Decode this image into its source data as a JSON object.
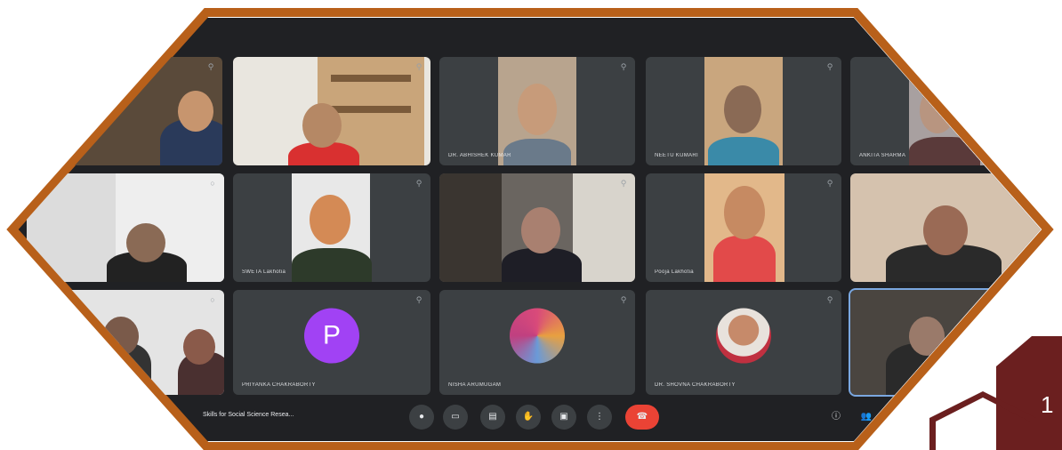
{
  "meeting": {
    "title": "Skills for Social Science Resea...",
    "participants": [
      {
        "name": "",
        "kind": "video"
      },
      {
        "name": "",
        "kind": "video"
      },
      {
        "name": "DR. ABHISHEK KUMAR",
        "kind": "video"
      },
      {
        "name": "NEETU KUMARI",
        "kind": "video"
      },
      {
        "name": "ANKITA SHARMA",
        "kind": "video"
      },
      {
        "name": "",
        "kind": "video"
      },
      {
        "name": "SWETA Lakhotia",
        "kind": "video"
      },
      {
        "name": "",
        "kind": "video"
      },
      {
        "name": "Pooja Lakhotia",
        "kind": "video"
      },
      {
        "name": "",
        "kind": "video"
      },
      {
        "name": "",
        "kind": "video"
      },
      {
        "name": "PRIYANKA CHAKRABORTY",
        "kind": "avatar",
        "initial": "P"
      },
      {
        "name": "NISHA ARUMUGAM",
        "kind": "photo"
      },
      {
        "name": "DR. SHOVNA CHAKRABORTY",
        "kind": "photo"
      },
      {
        "name": "",
        "kind": "video"
      }
    ]
  },
  "controls": {
    "buttons": [
      "mic-icon",
      "camera-icon",
      "captions-icon",
      "raise-hand-icon",
      "present-icon",
      "more-icon",
      "end-call-icon"
    ],
    "end_call_color": "#ea4335",
    "right": [
      "info-icon",
      "people-icon"
    ]
  },
  "slide": {
    "number": "1"
  },
  "colors": {
    "frame": "#b8601a",
    "panel": "#202124",
    "tile": "#3c4043",
    "slide_badge": "#6b1f1f"
  }
}
